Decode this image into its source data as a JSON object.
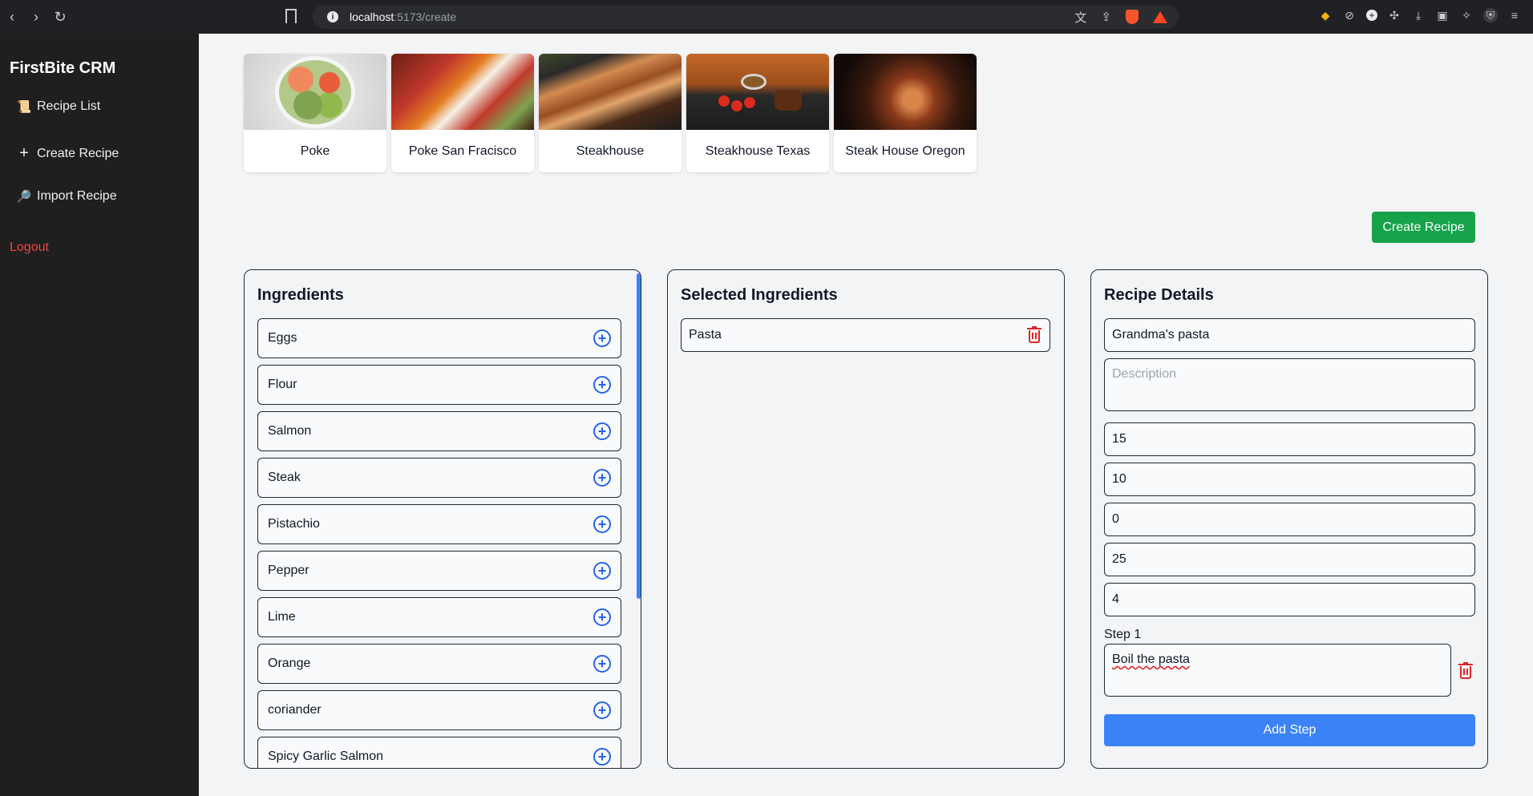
{
  "browser": {
    "url_host": "localhost",
    "url_path": ":5173/create"
  },
  "sidebar": {
    "brand": "FirstBite CRM",
    "items": [
      {
        "label": "Recipe List",
        "icon": "scroll-icon"
      },
      {
        "label": "Create Recipe",
        "icon": "plus-icon"
      },
      {
        "label": "Import Recipe",
        "icon": "magnifier-icon"
      }
    ],
    "logout": "Logout"
  },
  "recipes": [
    {
      "name": "Poke"
    },
    {
      "name": "Poke San Fracisco"
    },
    {
      "name": "Steakhouse"
    },
    {
      "name": "Steakhouse Texas"
    },
    {
      "name": "Steak House Oregon"
    }
  ],
  "create_button": "Create Recipe",
  "ingredients": {
    "title": "Ingredients",
    "items": [
      "Eggs",
      "Flour",
      "Salmon",
      "Steak",
      "Pistachio",
      "Pepper",
      "Lime",
      "Orange",
      "coriander",
      "Spicy Garlic Salmon"
    ]
  },
  "selected": {
    "title": "Selected Ingredients",
    "items": [
      "Pasta"
    ]
  },
  "details": {
    "title": "Recipe Details",
    "name": "Grandma's pasta",
    "description_placeholder": "Description",
    "fields": [
      "15",
      "10",
      "0",
      "25",
      "4"
    ],
    "step_label": "Step 1",
    "step_text": "Boil the pasta",
    "add_step": "Add Step"
  },
  "colors": {
    "accent_blue": "#3b82f6",
    "create_green": "#16a34a",
    "logout_red": "#ef4444",
    "delete_red": "#dc2626"
  }
}
